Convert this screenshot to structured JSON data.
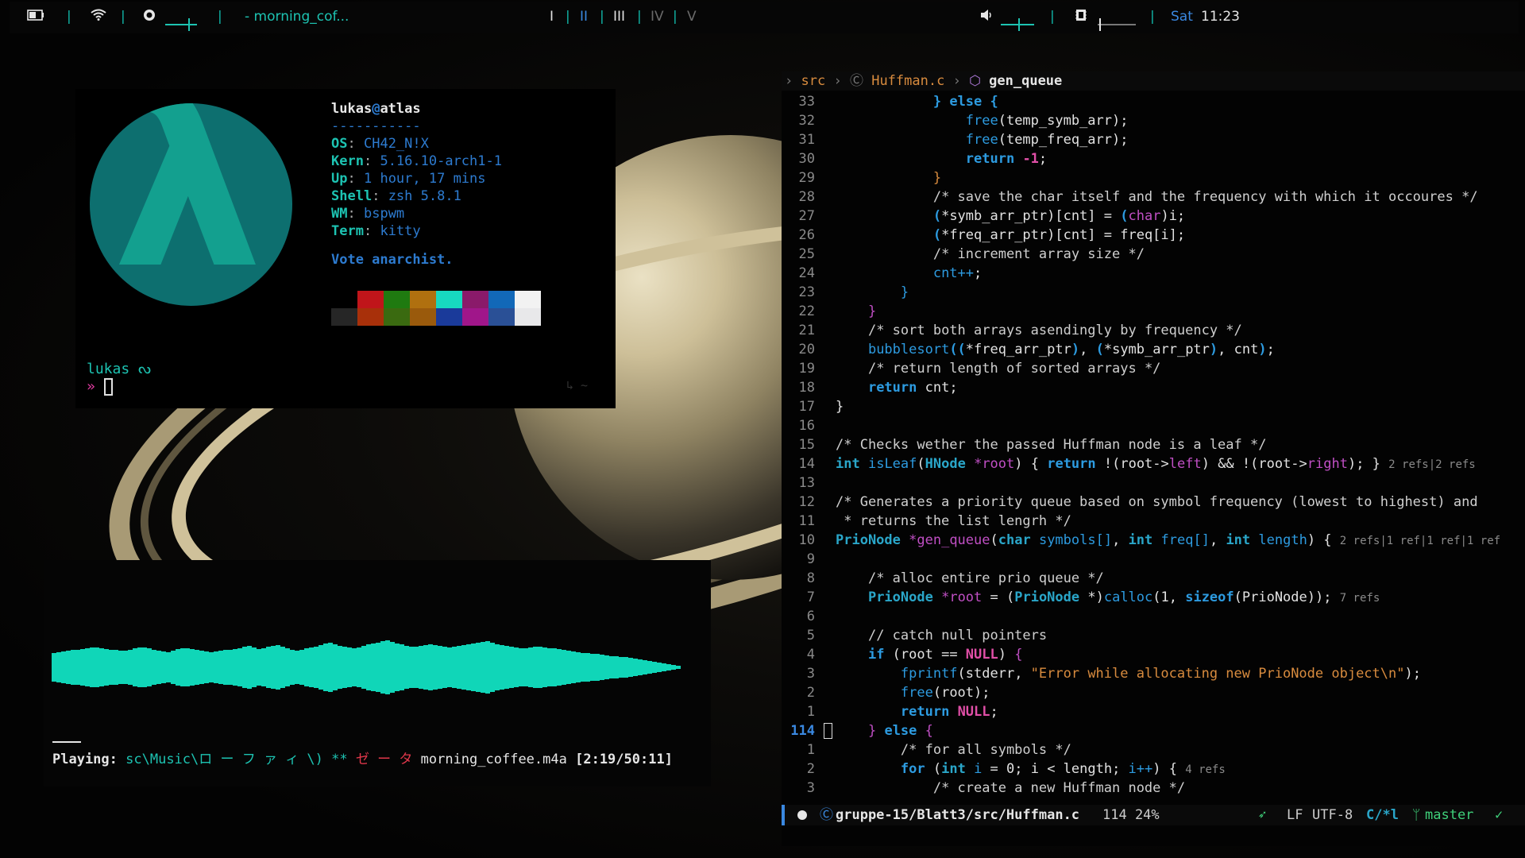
{
  "topbar": {
    "window_title": "- morning_cof...",
    "workspaces": [
      "I",
      "II",
      "III",
      "IV",
      "V"
    ],
    "active_workspace": "II",
    "day": "Sat",
    "time": "11:23",
    "separator": "|",
    "icons": [
      "battery-icon",
      "wifi-icon",
      "brightness-icon",
      "volume-icon",
      "memory-icon"
    ],
    "brightness_level": 0.75,
    "volume_level": 0.55,
    "memory_level": 0.05
  },
  "neofetch": {
    "user": "lukas",
    "at": "@",
    "host": "atlas",
    "divider": "-----------",
    "logo_glyph": "λ",
    "rows": [
      {
        "key": "OS",
        "value": "CH42_N!X"
      },
      {
        "key": "Kern",
        "value": "5.16.10-arch1-1"
      },
      {
        "key": "Up",
        "value": "1 hour, 17 mins"
      },
      {
        "key": "Shell",
        "value": "zsh 5.8.1"
      },
      {
        "key": "WM",
        "value": "bspwm"
      },
      {
        "key": "Term",
        "value": "kitty"
      }
    ],
    "colon": ":",
    "tagline": "Vote anarchist.",
    "palette_top": [
      "#000000",
      "#c0151a",
      "#1f7a10",
      "#b0700f",
      "#17d9c0",
      "#8a1a6a",
      "#1268b8",
      "#f2f2f2"
    ],
    "palette_bottom": [
      "#262626",
      "#a8300a",
      "#3a6a10",
      "#9a5a0c",
      "#1a3a9a",
      "#a0168a",
      "#2a5096",
      "#e8e8ea"
    ],
    "prompt_user": "lukas ",
    "prompt_symbol": "ᔓ",
    "prompt_arrow": "»",
    "right_prompt": "↳ ~"
  },
  "player": {
    "label": "Playing:",
    "path": "sc\\Music\\ロ ー フ ァ ィ \\)",
    "stars": "**",
    "tag": "ゼ ー タ",
    "file": "morning_coffee.m4a",
    "time": "[2:19/50:11]",
    "progress": 0.046
  },
  "editor": {
    "breadcrumb": {
      "root": "src",
      "file": "Huffman.c",
      "symbol": "gen_queue"
    },
    "lines": [
      {
        "n": "33",
        "html": "            <span class='kw'>}</span> <span class='kw'>else</span> <span class='kw'>{</span>"
      },
      {
        "n": "32",
        "html": "                <span class='fn'>free</span>(temp_symb_arr);"
      },
      {
        "n": "31",
        "html": "                <span class='fn'>free</span>(temp_freq_arr);"
      },
      {
        "n": "30",
        "html": "                <span class='kw'>return</span> <span class='ct'>-1</span>;"
      },
      {
        "n": "29",
        "html": "            <span class='st'>}</span>"
      },
      {
        "n": "28",
        "html": "            <span class='cm'>/* save the char itself and the frequency with which it occoures */</span>"
      },
      {
        "n": "27",
        "html": "            <span class='kw'>(</span>*symb_arr_ptr)[cnt] = <span class='kw'>(</span><span class='mg'>char</span>)i;"
      },
      {
        "n": "26",
        "html": "            <span class='kw'>(</span>*freq_arr_ptr)[cnt] = freq[i];"
      },
      {
        "n": "25",
        "html": "            <span class='cm'>/* increment array size */</span>"
      },
      {
        "n": "24",
        "html": "            <span class='fn'>cnt++</span>;"
      },
      {
        "n": "23",
        "html": "        <span class='fn'>}</span>"
      },
      {
        "n": "22",
        "html": "    <span class='mg'>}</span>"
      },
      {
        "n": "21",
        "html": "    <span class='cm'>/* sort both arrays asendingly by frequency */</span>"
      },
      {
        "n": "20",
        "html": "    <span class='fn'>bubblesort</span><span class='kw'>((</span>*freq_arr_ptr<span class='kw'>)</span>, <span class='kw'>(</span>*symb_arr_ptr<span class='kw'>)</span>, cnt<span class='kw'>)</span>;"
      },
      {
        "n": "19",
        "html": "    <span class='cm'>/* return length of sorted arrays */</span>"
      },
      {
        "n": "18",
        "html": "    <span class='kw'>return</span> cnt;"
      },
      {
        "n": "17",
        "html": "}"
      },
      {
        "n": "16",
        "html": ""
      },
      {
        "n": "15",
        "html": "<span class='cm'>/* Checks wether the passed Huffman node is a leaf */</span>"
      },
      {
        "n": "14",
        "html": "<span class='ty'>int</span> <span class='fn'>isLeaf</span>(<span class='ty'>HNode</span> <span class='mg'>*root</span>) { <span class='kw'>return</span> !(root-&gt;<span class='mg'>left</span>) &amp;&amp; !(root-&gt;<span class='mg'>right</span>); } <span class='ref'>2 refs|2 refs</span>"
      },
      {
        "n": "13",
        "html": ""
      },
      {
        "n": "12",
        "html": "<span class='cm'>/* Generates a priority queue based on symbol frequency (lowest to highest) and</span>"
      },
      {
        "n": "11",
        "html": "<span class='cm'> * returns the list lengrh */</span>"
      },
      {
        "n": "10",
        "html": "<span class='ty'>PrioNode</span> <span class='mg'>*gen_queue</span>(<span class='ty'>char</span> <span class='fn'>symbols[]</span>, <span class='ty'>int</span> <span class='fn'>freq[]</span>, <span class='ty'>int</span> <span class='fn'>length</span>) { <span class='ref'>2 refs|1 ref|1 ref|1 ref</span>"
      },
      {
        "n": "9",
        "html": ""
      },
      {
        "n": "8",
        "html": "    <span class='cm'>/* alloc entire prio queue */</span>"
      },
      {
        "n": "7",
        "html": "    <span class='ty'>PrioNode</span> <span class='mg'>*root</span> = (<span class='ty'>PrioNode</span> *)<span class='fn'>calloc</span>(1, <span class='kw'>sizeof</span>(PrioNode)); <span class='ref'>7 refs</span>"
      },
      {
        "n": "6",
        "html": ""
      },
      {
        "n": "5",
        "html": "    <span class='cm'>// catch null pointers</span>"
      },
      {
        "n": "4",
        "html": "    <span class='kw'>if</span> (root == <span class='ct'>NULL</span>) <span class='mg'>{</span>"
      },
      {
        "n": "3",
        "html": "        <span class='fn'>fprintf</span>(stderr, <span class='st'>\"Error while allocating new PrioNode object\\n\"</span>);"
      },
      {
        "n": "2",
        "html": "        <span class='fn'>free</span>(root);"
      },
      {
        "n": "1",
        "html": "        <span class='kw'>return</span> <span class='ct'>NULL</span>;"
      },
      {
        "n": "114",
        "cur": true,
        "html": "    <span class='mg'>}</span> <span class='kw'>else</span> <span class='mg'>{</span>"
      },
      {
        "n": "1",
        "html": "        <span class='cm'>/* for all symbols */</span>"
      },
      {
        "n": "2",
        "html": "        <span class='kw'>for</span> (<span class='ty'>int</span> <span class='fn'>i</span> = 0; i &lt; length; <span class='fn'>i++</span>) { <span class='ref'>4 refs</span>"
      },
      {
        "n": "3",
        "html": "            <span class='cm'>/* create a new Huffman node */</span>"
      }
    ],
    "status": {
      "path": "gruppe-15/Blatt3/src/Huffman.c",
      "position": "114 24%",
      "eol": "LF",
      "encoding": "UTF-8",
      "lang": "C/*l",
      "branch": "master",
      "check": "✓"
    }
  },
  "visualizer": {
    "color": "#10d6b8",
    "bars": [
      18,
      19,
      20,
      21,
      22,
      22,
      23,
      24,
      25,
      25,
      24,
      23,
      22,
      22,
      21,
      21,
      22,
      24,
      25,
      25,
      24,
      22,
      21,
      20,
      19,
      21,
      23,
      24,
      24,
      23,
      22,
      21,
      20,
      19,
      20,
      21,
      22,
      22,
      23,
      24,
      26,
      27,
      25,
      23,
      24,
      26,
      27,
      28,
      26,
      24,
      22,
      21,
      22,
      24,
      25,
      26,
      28,
      30,
      31,
      29,
      27,
      26,
      25,
      24,
      25,
      27,
      29,
      30,
      31,
      33,
      34,
      32,
      30,
      29,
      27,
      26,
      26,
      27,
      28,
      29,
      28,
      27,
      26,
      25,
      26,
      27,
      28,
      29,
      30,
      31,
      32,
      33,
      31,
      29,
      28,
      27,
      26,
      25,
      24,
      24,
      25,
      26,
      26,
      25,
      24,
      24,
      23,
      22,
      21,
      20,
      19,
      18,
      18,
      17,
      17,
      16,
      15,
      14,
      14,
      13,
      13,
      12,
      11,
      10,
      9,
      8,
      7,
      6,
      5,
      4,
      3,
      2
    ]
  }
}
